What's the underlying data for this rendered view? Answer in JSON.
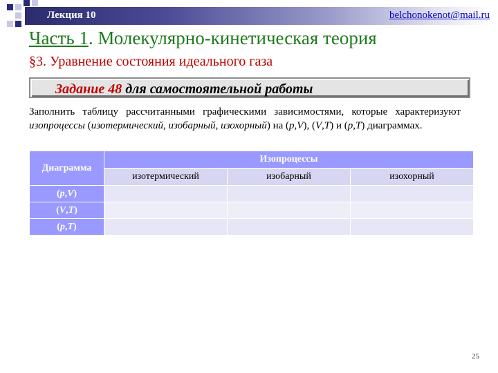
{
  "header": {
    "lecture": "Лекция 10",
    "email": "belchonokenot@mail.ru"
  },
  "title": {
    "part": "Часть 1",
    "rest": ". Молекулярно-кинетическая теория"
  },
  "subtitle": "§3. Уравнение состояния идеального газа",
  "task": {
    "label": "Задание 48",
    "rest": " для самостоятельной работы"
  },
  "paragraph": {
    "t1": "Заполнить таблицу рассчитанными графическими зависимостями, которые характеризуют ",
    "i1": "изопроцессы",
    "t2": " (",
    "i2": "изотермический",
    "t3": ", ",
    "i3": "изобарный",
    "t4": ", ",
    "i4": "изохорный",
    "t5": ") на (",
    "i5": "p",
    "t6": ",",
    "i6": "V",
    "t7": "), (",
    "i7": "V",
    "t8": ",",
    "i8": "T",
    "t9": ") и (",
    "i9": "p",
    "t10": ",",
    "i10": "T",
    "t11": ") диаграммах."
  },
  "table": {
    "diagram_header": "Диаграмма",
    "group_header": "Изопроцессы",
    "columns": [
      "изотермический",
      "изобарный",
      "изохорный"
    ],
    "rows": [
      {
        "a": "p",
        "b": "V"
      },
      {
        "a": "V",
        "b": "T"
      },
      {
        "a": "p",
        "b": "T"
      }
    ]
  },
  "colors": {
    "title": "#1f7a1f",
    "subtitle": "#c00000",
    "table_header": "#9999ff"
  },
  "page_number": "25"
}
